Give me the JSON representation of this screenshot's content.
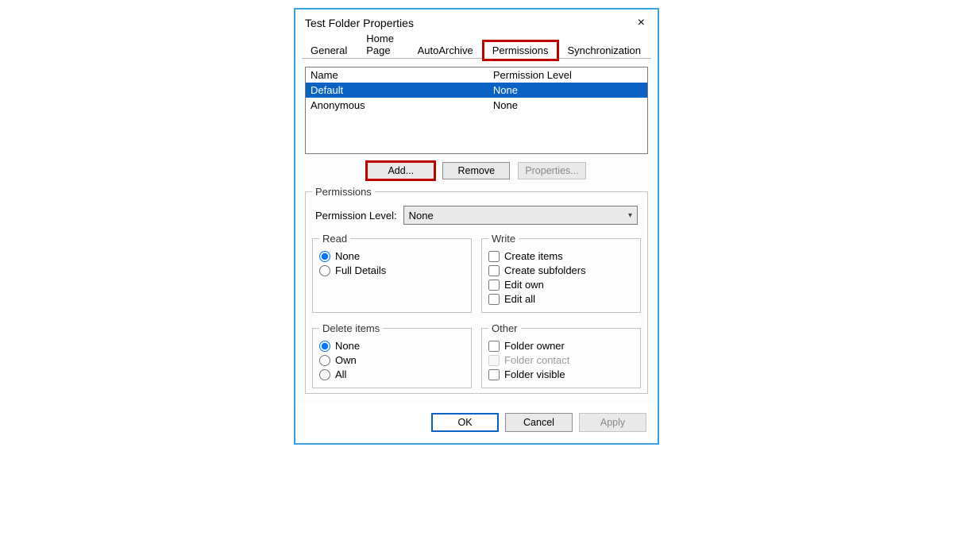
{
  "dialog": {
    "title": "Test Folder Properties",
    "close": "×"
  },
  "tabs": {
    "general": "General",
    "homepage": "Home Page",
    "autoarchive": "AutoArchive",
    "permissions": "Permissions",
    "sync": "Synchronization"
  },
  "userlist": {
    "col_name": "Name",
    "col_level": "Permission Level",
    "rows": [
      {
        "name": "Default",
        "level": "None",
        "selected": true
      },
      {
        "name": "Anonymous",
        "level": "None",
        "selected": false
      }
    ]
  },
  "buttons": {
    "add": "Add...",
    "remove": "Remove",
    "properties": "Properties..."
  },
  "permissions": {
    "legend": "Permissions",
    "level_label": "Permission Level:",
    "level_value": "None",
    "read": {
      "legend": "Read",
      "none": "None",
      "full": "Full Details"
    },
    "write": {
      "legend": "Write",
      "create_items": "Create items",
      "create_subfolders": "Create subfolders",
      "edit_own": "Edit own",
      "edit_all": "Edit all"
    },
    "delete": {
      "legend": "Delete items",
      "none": "None",
      "own": "Own",
      "all": "All"
    },
    "other": {
      "legend": "Other",
      "folder_owner": "Folder owner",
      "folder_contact": "Folder contact",
      "folder_visible": "Folder visible"
    }
  },
  "footer": {
    "ok": "OK",
    "cancel": "Cancel",
    "apply": "Apply"
  },
  "colors": {
    "highlight": "#c00000",
    "selection": "#0a63c4",
    "frame": "#3aa0de"
  }
}
